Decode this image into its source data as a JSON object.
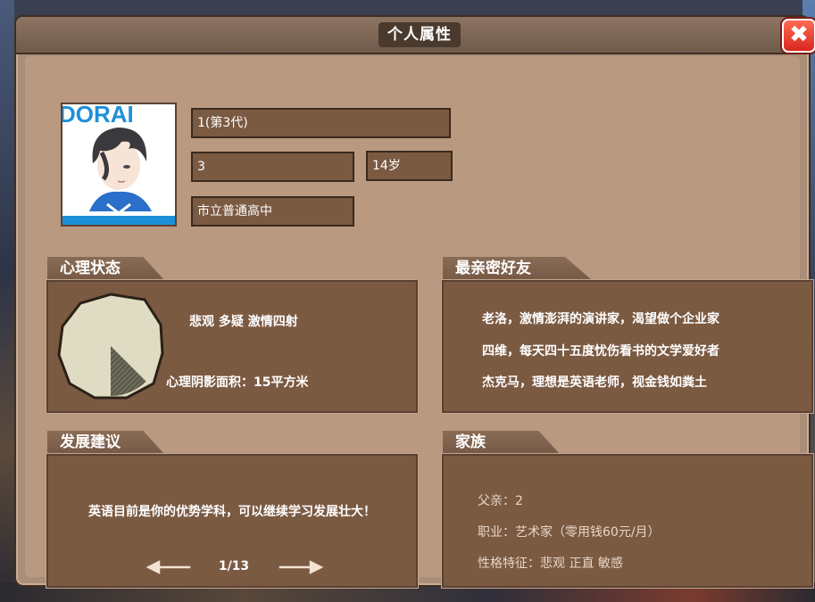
{
  "title": "个人属性",
  "close_label": "✖",
  "avatar": {
    "banner_text": "DORAI"
  },
  "profile": {
    "name": "1(第3代)",
    "id": "3",
    "age": "14岁",
    "school": "市立普通高中"
  },
  "mental": {
    "heading": "心理状态",
    "tags": "悲观 多疑 激情四射",
    "shadow_area": "心理阴影面积：15平方米",
    "shadow_fraction": 0.125
  },
  "friends": {
    "heading": "最亲密好友",
    "items": [
      "老洛，激情澎湃的演讲家，渴望做个企业家",
      "四维，每天四十五度忧伤看书的文学爱好者",
      "杰克马，理想是英语老师，视金钱如粪土"
    ]
  },
  "advice": {
    "heading": "发展建议",
    "text": "英语目前是你的优势学科，可以继续学习发展壮大！",
    "page": "1/13"
  },
  "family": {
    "heading": "家族",
    "father": "父亲：2",
    "job": "职业：艺术家（零用钱60元/月）",
    "traits": "性格特征：悲观 正直 敏感"
  },
  "colors": {
    "panel": "#7b5a42",
    "dialog": "#ab8e78",
    "close": "#e33a2b",
    "avatar_banner": "#1e90d8"
  }
}
